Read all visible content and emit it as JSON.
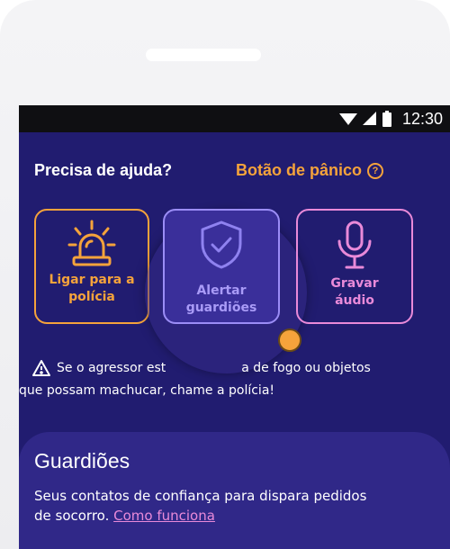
{
  "status": {
    "time": "12:30"
  },
  "header": {
    "title": "Precisa de ajuda?",
    "panic_label": "Botão de pânico",
    "panic_icon": "help-circle-icon"
  },
  "actions": [
    {
      "label_line1": "Ligar para a",
      "label_line2": "polícia",
      "icon": "siren-icon",
      "color": "#f5a33b"
    },
    {
      "label_line1": "Alertar",
      "label_line2": "guardiões",
      "icon": "shield-check-icon",
      "color": "#a99bf7"
    },
    {
      "label_line1": "Gravar",
      "label_line2": "áudio",
      "icon": "microphone-icon",
      "color": "#e98ad9"
    }
  ],
  "warning": {
    "line1_start": "Se o agressor est",
    "line1_end": "a de fogo ou objetos",
    "line2": "que possam machucar, chame a polícia!",
    "icon": "warning-icon"
  },
  "guardians": {
    "title": "Guardiões",
    "description_line1": "Seus contatos de confiança para dispara pedidos",
    "description_line2_prefix": "de socorro. ",
    "link_label": "Como funciona"
  },
  "colors": {
    "background": "#211c70",
    "accent_orange": "#f5a33b",
    "accent_purple": "#a99bf7",
    "accent_pink": "#e98ad9"
  }
}
